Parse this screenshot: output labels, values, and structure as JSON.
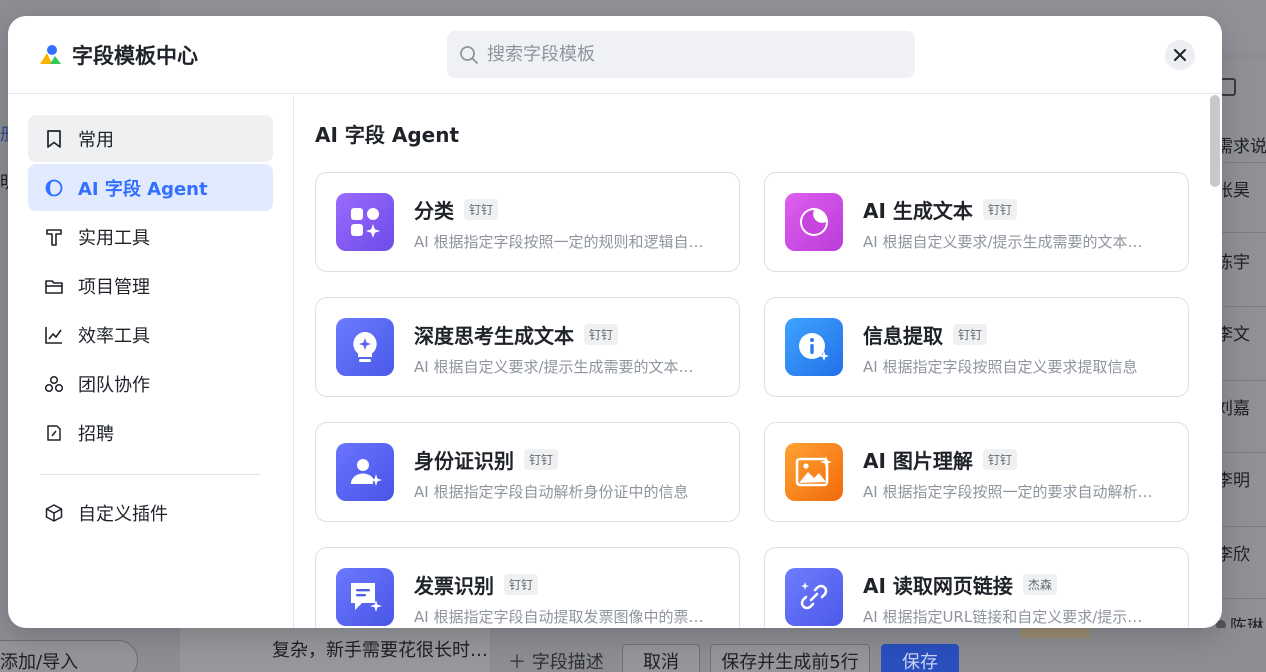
{
  "background": {
    "left_texts": [
      "册",
      "明"
    ],
    "people": [
      "需求说",
      "张昊",
      "陈宇",
      "李文",
      "刘嘉",
      "李明",
      "李欣",
      "陈琳"
    ],
    "add_import": "添加/导入",
    "card_snippet": "复杂，新手需要花很长时…",
    "field_desc": "＋ 字段描述",
    "cancel": "取消",
    "save_gen": "保存并生成前5行",
    "save": "保存"
  },
  "modal": {
    "title": "字段模板中心",
    "search_placeholder": "搜索字段模板"
  },
  "sidebar": {
    "items": [
      {
        "label": "常用",
        "icon": "bookmark-icon"
      },
      {
        "label": "AI 字段 Agent",
        "icon": "ai-agent-icon"
      },
      {
        "label": "实用工具",
        "icon": "tool-icon"
      },
      {
        "label": "项目管理",
        "icon": "folder-icon"
      },
      {
        "label": "效率工具",
        "icon": "chart-line-icon"
      },
      {
        "label": "团队协作",
        "icon": "team-icon"
      },
      {
        "label": "招聘",
        "icon": "recruit-icon"
      }
    ],
    "custom": {
      "label": "自定义插件",
      "icon": "cube-icon"
    }
  },
  "content": {
    "section_title": "AI 字段 Agent",
    "cards": [
      {
        "title": "分类",
        "tag": "钉钉",
        "desc": "AI 根据指定字段按照一定的规则和逻辑自…",
        "icon": "category-icon",
        "color": "#8a5cf5"
      },
      {
        "title": "AI 生成文本",
        "tag": "钉钉",
        "desc": "AI 根据自定义要求/提示生成需要的文本…",
        "icon": "generate-text-icon",
        "color": "#d14fe0"
      },
      {
        "title": "深度思考生成文本",
        "tag": "钉钉",
        "desc": "AI 根据自定义要求/提示生成需要的文本…",
        "icon": "lightbulb-icon",
        "color": "#5b6cf6"
      },
      {
        "title": "信息提取",
        "tag": "钉钉",
        "desc": "AI 根据指定字段按照自定义要求提取信息",
        "icon": "info-extract-icon",
        "color": "#2f8df5"
      },
      {
        "title": "身份证识别",
        "tag": "钉钉",
        "desc": "AI 根据指定字段自动解析身份证中的信息",
        "icon": "id-card-icon",
        "color": "#5b64f0"
      },
      {
        "title": "AI 图片理解",
        "tag": "钉钉",
        "desc": "AI 根据指定字段按照一定的要求自动解析…",
        "icon": "image-understand-icon",
        "color": "#f7821a"
      },
      {
        "title": "发票识别",
        "tag": "钉钉",
        "desc": "AI 根据指定字段自动提取发票图像中的票…",
        "icon": "invoice-icon",
        "color": "#5967f0"
      },
      {
        "title": "AI 读取网页链接",
        "tag": "杰森",
        "desc": "AI 根据指定URL链接和自定义要求/提示…",
        "icon": "link-icon",
        "color": "#5e6ef2"
      }
    ]
  }
}
